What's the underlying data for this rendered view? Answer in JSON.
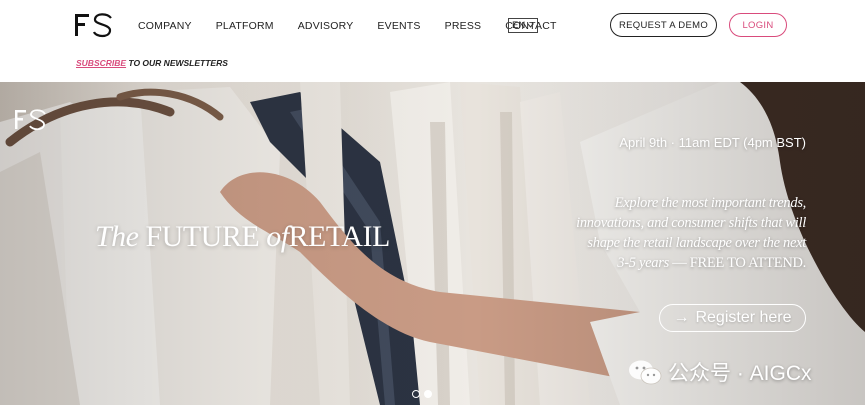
{
  "header": {
    "logo_text": "FS",
    "nav": [
      {
        "label": "COMPANY"
      },
      {
        "label": "PLATFORM"
      },
      {
        "label": "ADVISORY"
      },
      {
        "label": "EVENTS"
      },
      {
        "label": "PRESS"
      },
      {
        "label": "CONTACT"
      }
    ],
    "language": "EN",
    "demo_label": "REQUEST A DEMO",
    "login_label": "LOGIN"
  },
  "subscribe": {
    "link_label": "SUBSCRIBE",
    "rest": " TO OUR NEWSLETTERS"
  },
  "hero": {
    "title_the": "The",
    "title_future": "FUTURE",
    "title_of": "of",
    "title_retail": "RETAIL",
    "date": "April 9th · 11am EDT (4pm BST)",
    "description": "Explore the most important trends, innovations, and consumer shifts that will shape the retail landscape over the next 3-5 years",
    "free_note": " — FREE TO ATTEND.",
    "register_label": "Register here",
    "slides_total": 2,
    "slide_active": 2
  },
  "watermark": {
    "text": "公众号 · AIGCx"
  },
  "colors": {
    "accent_pink": "#d94b7c",
    "text_dark": "#222222"
  },
  "icons": {
    "arrow": "right-arrow-icon",
    "chevron": "chevron-down-icon",
    "wechat": "wechat-icon"
  }
}
